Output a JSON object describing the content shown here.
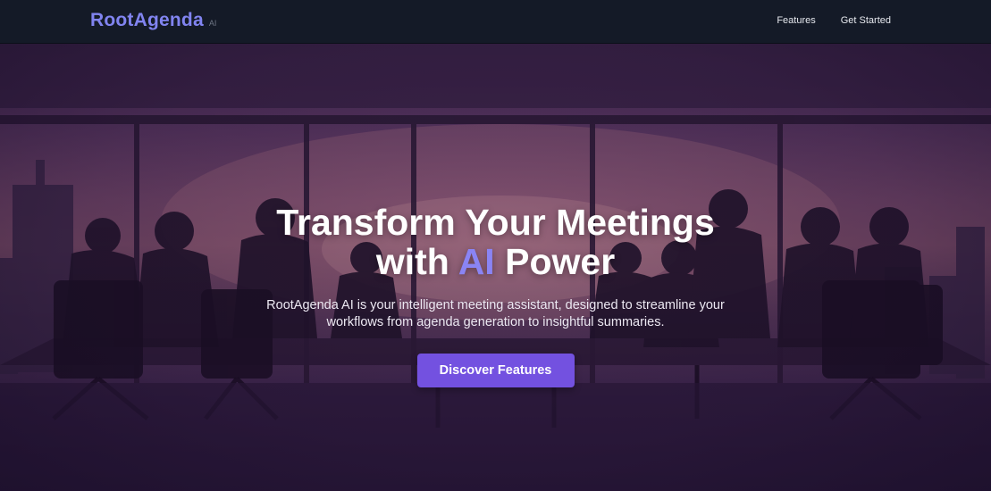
{
  "brand": {
    "name": "RootAgenda",
    "tag": "AI",
    "color": "#8184f0"
  },
  "nav": {
    "items": [
      {
        "label": "Features"
      },
      {
        "label": "Get Started"
      }
    ]
  },
  "hero": {
    "title_line1": "Transform Your Meetings",
    "title_with": "with",
    "title_accent": "AI",
    "title_end": "Power",
    "subtitle": "RootAgenda AI is your intelligent meeting assistant, designed to streamline your workflows from agenda generation to insightful summaries.",
    "cta_label": "Discover Features",
    "background": "boardroom-silhouette-image",
    "accent_color": "#8a84f4",
    "button_color": "#7351e0"
  }
}
